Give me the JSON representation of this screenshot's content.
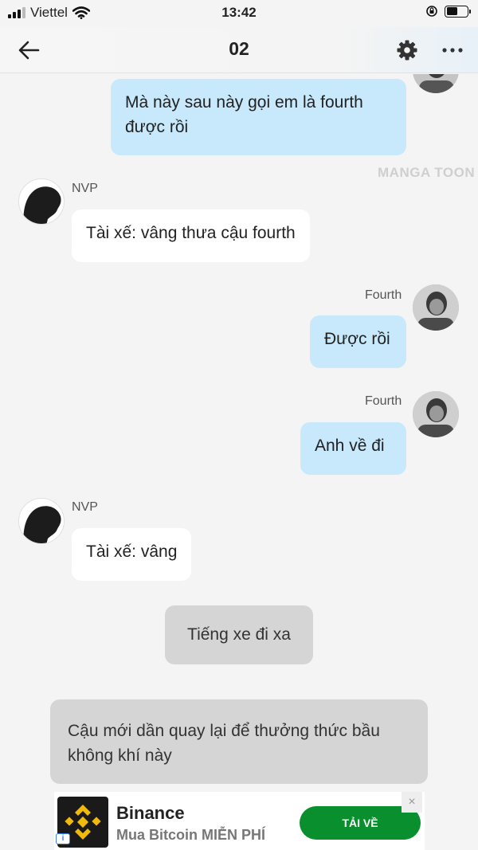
{
  "status_bar": {
    "carrier": "Viettel",
    "time": "13:42",
    "battery_percent": 55
  },
  "header": {
    "title": "02",
    "back_icon": "arrow-left-icon",
    "settings_icon": "gear-icon",
    "more_icon": "more-horizontal-icon"
  },
  "watermark": "MANGA TOON",
  "messages": [
    {
      "side": "right",
      "speaker": "",
      "text": "Mà này sau này gọi em là fourth được rồi"
    },
    {
      "side": "left",
      "speaker": "NVP",
      "text": "Tài xế: vâng thưa cậu fourth"
    },
    {
      "side": "right",
      "speaker": "Fourth",
      "text": "Được rồi"
    },
    {
      "side": "right",
      "speaker": "Fourth",
      "text": "Anh về đi"
    },
    {
      "side": "left",
      "speaker": "NVP",
      "text": "Tài xế: vâng"
    },
    {
      "side": "narration",
      "speaker": "",
      "text": "Tiếng xe đi xa"
    },
    {
      "side": "narration",
      "speaker": "",
      "text": "Cậu mới dần quay lại để thưởng thức bầu không khí này"
    }
  ],
  "ad": {
    "brand": "Binance",
    "subtitle": "Mua Bitcoin MIỄN PHÍ",
    "cta": "TẢI VỀ",
    "close": "×",
    "info": "i",
    "brand_color": "#f0b90b",
    "cta_color": "#0a8f2f"
  },
  "colors": {
    "bubble_right": "#c7e9fb",
    "bubble_left": "#ffffff",
    "bubble_narration": "#d5d5d5",
    "background": "#f4f4f4"
  }
}
